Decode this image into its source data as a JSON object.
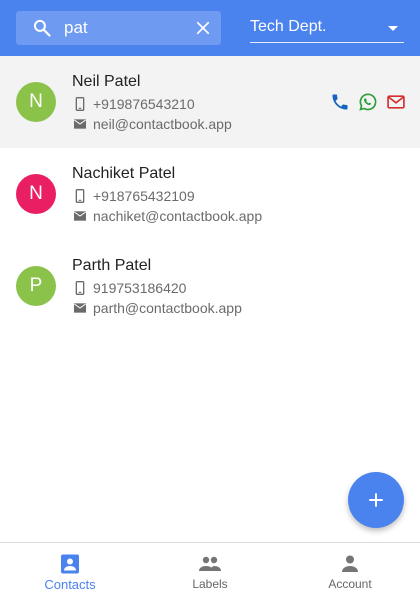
{
  "header": {
    "search": {
      "value": "pat",
      "placeholder": ""
    },
    "department": "Tech Dept."
  },
  "contacts": [
    {
      "initial": "N",
      "name": "Neil Patel",
      "phone": "+919876543210",
      "email": "neil@contactbook.app",
      "avatar_color": "#8bc34a",
      "selected": true
    },
    {
      "initial": "N",
      "name": "Nachiket Patel",
      "phone": "+918765432109",
      "email": "nachiket@contactbook.app",
      "avatar_color": "#e91e63",
      "selected": false
    },
    {
      "initial": "P",
      "name": "Parth Patel",
      "phone": "919753186420",
      "email": "parth@contactbook.app",
      "avatar_color": "#8bc34a",
      "selected": false
    }
  ],
  "row_actions": [
    {
      "icon": "phone-icon",
      "color": "#1565c0"
    },
    {
      "icon": "whatsapp-icon",
      "color": "#2e9d3b"
    },
    {
      "icon": "gmail-icon",
      "color": "#d32f2f"
    }
  ],
  "fab": {
    "icon": "plus-icon"
  },
  "bottom_nav": [
    {
      "label": "Contacts",
      "icon": "contacts-icon",
      "active": true
    },
    {
      "label": "Labels",
      "icon": "people-icon",
      "active": false
    },
    {
      "label": "Account",
      "icon": "person-icon",
      "active": false
    }
  ],
  "colors": {
    "primary": "#4a82ee",
    "selected_row": "#f3f3f3",
    "secondary_text": "#6b6b6b"
  }
}
